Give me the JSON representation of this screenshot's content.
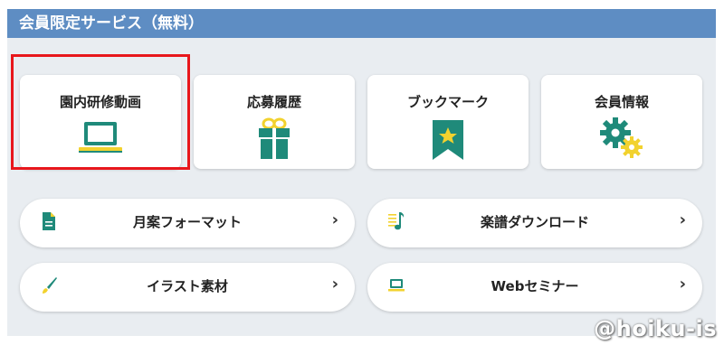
{
  "section": {
    "title": "会員限定サービス（無料）"
  },
  "cards": [
    {
      "label": "園内研修動画",
      "icon": "laptop-icon"
    },
    {
      "label": "応募履歴",
      "icon": "gift-icon"
    },
    {
      "label": "ブックマーク",
      "icon": "bookmark-star-icon"
    },
    {
      "label": "会員情報",
      "icon": "gears-icon"
    }
  ],
  "links": [
    {
      "label": "月案フォーマット",
      "icon": "document-icon",
      "chevron": "›"
    },
    {
      "label": "楽譜ダウンロード",
      "icon": "music-note-icon",
      "chevron": "›"
    },
    {
      "label": "イラスト素材",
      "icon": "brush-icon",
      "chevron": "›"
    },
    {
      "label": "Webセミナー",
      "icon": "monitor-icon",
      "chevron": "›"
    }
  ],
  "watermark": "@hoiku-is",
  "colors": {
    "header": "#5e8dc3",
    "icon_teal": "#1f8a7a",
    "icon_yellow": "#f2d22e",
    "highlight": "#e8171c"
  }
}
